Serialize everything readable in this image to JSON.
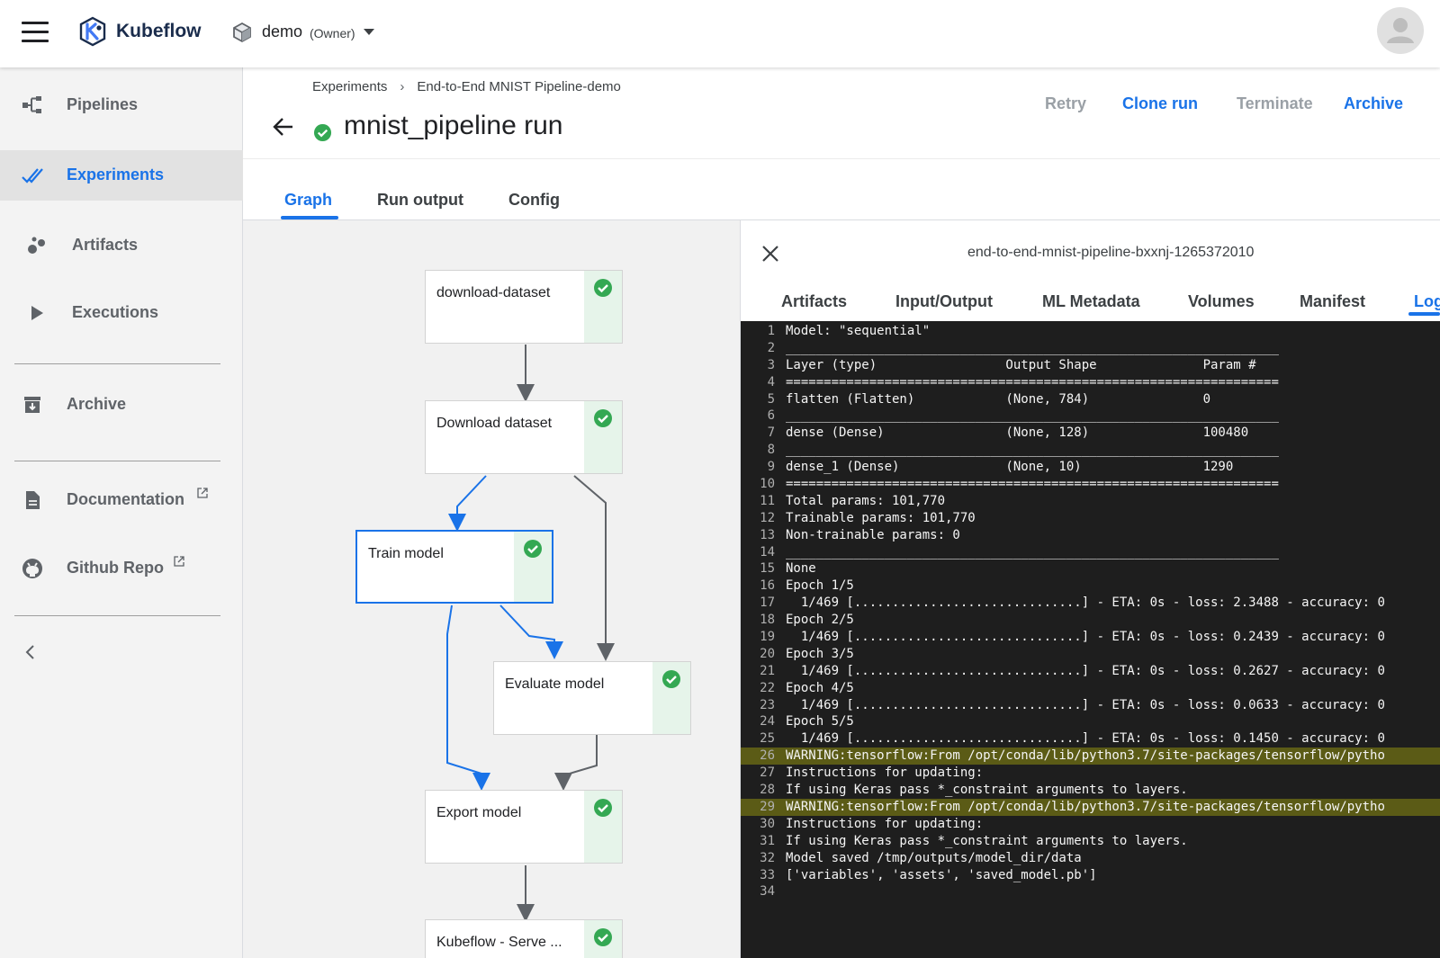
{
  "topbar": {
    "app_name": "Kubeflow",
    "namespace": "demo",
    "namespace_role": "(Owner)"
  },
  "sidebar": {
    "items": [
      {
        "label": "Pipelines",
        "icon": "pipelines-icon"
      },
      {
        "label": "Experiments",
        "icon": "experiments-icon",
        "active": true
      },
      {
        "label": "Artifacts",
        "icon": "artifacts-icon"
      },
      {
        "label": "Executions",
        "icon": "executions-icon"
      },
      {
        "label": "Archive",
        "icon": "archive-icon"
      },
      {
        "label": "Documentation",
        "icon": "documentation-icon",
        "external": true
      },
      {
        "label": "Github Repo",
        "icon": "github-icon",
        "external": true
      }
    ]
  },
  "header": {
    "breadcrumb": [
      "Experiments",
      "End-to-End MNIST Pipeline-demo"
    ],
    "title": "mnist_pipeline run",
    "actions": {
      "retry": "Retry",
      "clone": "Clone run",
      "terminate": "Terminate",
      "archive": "Archive"
    }
  },
  "main_tabs": [
    "Graph",
    "Run output",
    "Config"
  ],
  "graph": {
    "nodes": [
      {
        "label": "download-dataset",
        "status": "succeeded"
      },
      {
        "label": "Download dataset",
        "status": "succeeded"
      },
      {
        "label": "Train model",
        "status": "succeeded",
        "selected": true
      },
      {
        "label": "Evaluate model",
        "status": "succeeded"
      },
      {
        "label": "Export model",
        "status": "succeeded"
      },
      {
        "label": "Kubeflow - Serve ...",
        "status": "succeeded"
      }
    ]
  },
  "panel": {
    "title": "end-to-end-mnist-pipeline-bxxnj-1265372010",
    "tabs": [
      "Artifacts",
      "Input/Output",
      "ML Metadata",
      "Volumes",
      "Manifest",
      "Logs"
    ],
    "active_tab": "Logs",
    "logs": [
      {
        "n": "1",
        "t": "Model: \"sequential\""
      },
      {
        "n": "2",
        "t": "_________________________________________________________________"
      },
      {
        "n": "3",
        "t": "Layer (type)                 Output Shape              Param #"
      },
      {
        "n": "4",
        "t": "================================================================="
      },
      {
        "n": "5",
        "t": "flatten (Flatten)            (None, 784)               0"
      },
      {
        "n": "6",
        "t": "_________________________________________________________________"
      },
      {
        "n": "7",
        "t": "dense (Dense)                (None, 128)               100480"
      },
      {
        "n": "8",
        "t": "_________________________________________________________________"
      },
      {
        "n": "9",
        "t": "dense_1 (Dense)              (None, 10)                1290"
      },
      {
        "n": "10",
        "t": "================================================================="
      },
      {
        "n": "11",
        "t": "Total params: 101,770"
      },
      {
        "n": "12",
        "t": "Trainable params: 101,770"
      },
      {
        "n": "13",
        "t": "Non-trainable params: 0"
      },
      {
        "n": "14",
        "t": "_________________________________________________________________"
      },
      {
        "n": "15",
        "t": "None"
      },
      {
        "n": "16",
        "t": "Epoch 1/5"
      },
      {
        "n": "17",
        "t": "  1/469 [..............................] - ETA: 0s - loss: 2.3488 - accuracy: 0"
      },
      {
        "n": "18",
        "t": "Epoch 2/5"
      },
      {
        "n": "19",
        "t": "  1/469 [..............................] - ETA: 0s - loss: 0.2439 - accuracy: 0"
      },
      {
        "n": "20",
        "t": "Epoch 3/5"
      },
      {
        "n": "21",
        "t": "  1/469 [..............................] - ETA: 0s - loss: 0.2627 - accuracy: 0"
      },
      {
        "n": "22",
        "t": "Epoch 4/5"
      },
      {
        "n": "23",
        "t": "  1/469 [..............................] - ETA: 0s - loss: 0.0633 - accuracy: 0"
      },
      {
        "n": "24",
        "t": "Epoch 5/5"
      },
      {
        "n": "25",
        "t": "  1/469 [..............................] - ETA: 0s - loss: 0.1450 - accuracy: 0"
      },
      {
        "n": "26",
        "t": "WARNING:tensorflow:From /opt/conda/lib/python3.7/site-packages/tensorflow/pytho",
        "warn": true
      },
      {
        "n": "27",
        "t": "Instructions for updating:"
      },
      {
        "n": "28",
        "t": "If using Keras pass *_constraint arguments to layers."
      },
      {
        "n": "29",
        "t": "WARNING:tensorflow:From /opt/conda/lib/python3.7/site-packages/tensorflow/pytho",
        "warn": true
      },
      {
        "n": "30",
        "t": "Instructions for updating:"
      },
      {
        "n": "31",
        "t": "If using Keras pass *_constraint arguments to layers."
      },
      {
        "n": "32",
        "t": "Model saved /tmp/outputs/model_dir/data"
      },
      {
        "n": "33",
        "t": "['variables', 'assets', 'saved_model.pb']"
      },
      {
        "n": "34",
        "t": ""
      }
    ]
  },
  "colors": {
    "accent": "#1a73e8",
    "success": "#34a853",
    "log_background": "#1e1e1e",
    "warning_highlight": "#5b5b16"
  }
}
